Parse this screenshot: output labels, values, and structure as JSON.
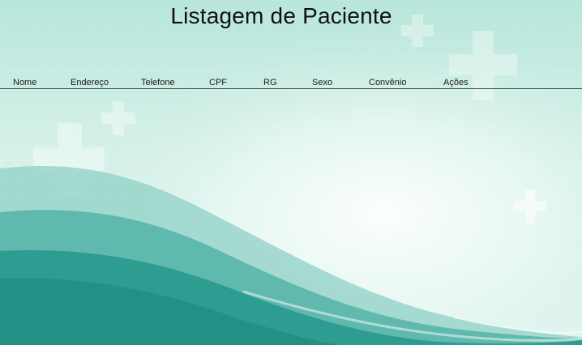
{
  "page": {
    "title": "Listagem de Paciente"
  },
  "table": {
    "columns": [
      "Nome",
      "Endereço",
      "Telefone",
      "CPF",
      "RG",
      "Sexo",
      "Convênio",
      "Ações"
    ],
    "rows": []
  },
  "theme": {
    "background": "#dff3ee",
    "wave_dark": "#2f9c92",
    "wave_mid": "#55b3a8",
    "wave_light": "#8fd0c5",
    "cross": "#ffffff"
  }
}
